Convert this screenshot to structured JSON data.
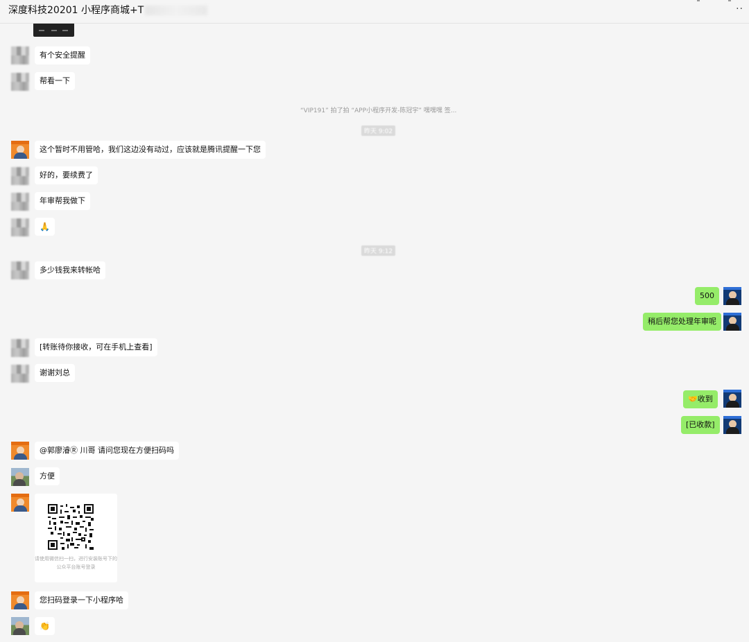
{
  "header": {
    "title": "深度科技20201 小程序商城+T",
    "more": "··"
  },
  "system_notice": "“VIP191” 拍了拍 “APP小程序开发-陈冠宇” 嘿嘿嘿 签...",
  "timestamps": [
    "昨天 9:02",
    "昨天 9:12"
  ],
  "messages": [
    {
      "text": "有个安全提醒"
    },
    {
      "text": "帮看一下"
    },
    {
      "text": "这个暂时不用管哈，我们这边没有动过，应该就是腾讯提醒一下您"
    },
    {
      "text": "好的，要续费了"
    },
    {
      "text": "年审帮我做下"
    },
    {
      "text": "🙏"
    },
    {
      "text": "多少钱我来转帐哈"
    },
    {
      "text": "500"
    },
    {
      "text": "稍后帮您处理年审呢"
    },
    {
      "text": "[转账待你接收，可在手机上查看]"
    },
    {
      "text": "谢谢刘总"
    },
    {
      "text": "🤝收到"
    },
    {
      "text": "[已收款]"
    },
    {
      "text": "@郭廖濬Ⓡ 川哥 请问您现在方便扫码吗"
    },
    {
      "text": "方便"
    },
    {
      "text": "您扫码登录一下小程序哈"
    },
    {
      "text": "👏"
    }
  ],
  "qr_card": {
    "caption_line1": "请使用微信扫一扫，进行安装账号下的",
    "caption_line2": "公众平台账号登录"
  },
  "colors": {
    "self_bubble": "#95ec69",
    "other_bubble": "#ffffff",
    "background": "#f5f5f5"
  }
}
